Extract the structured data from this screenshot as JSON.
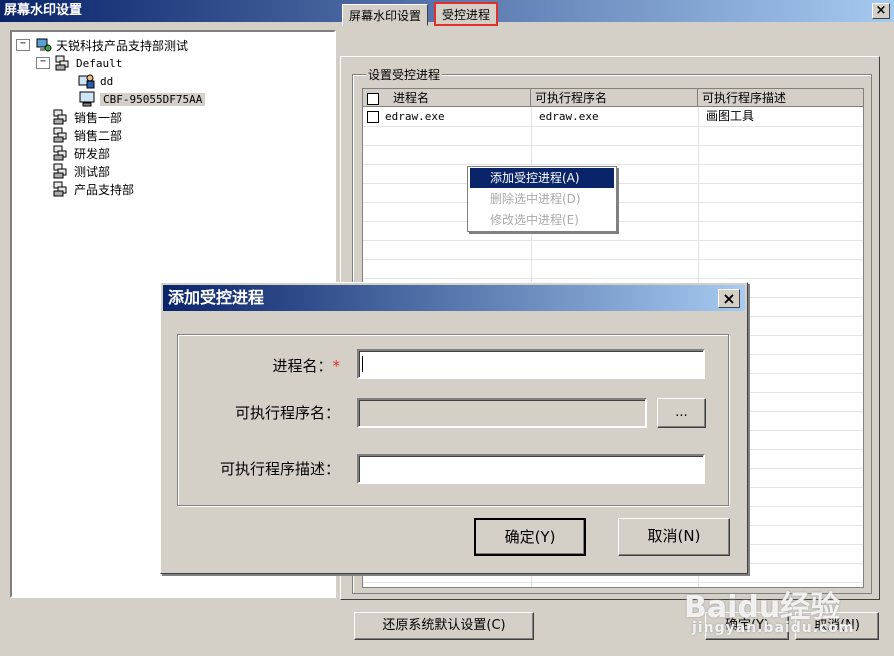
{
  "window": {
    "title": "屏幕水印设置",
    "close": "×"
  },
  "tree": {
    "root": "天锐科技产品支持部测试",
    "default_group": "Default",
    "users": [
      "dd",
      "CBF-95055DF75AA"
    ],
    "departments": [
      "销售一部",
      "销售二部",
      "研发部",
      "测试部",
      "产品支持部"
    ],
    "expander_minus": "−"
  },
  "tabs": [
    {
      "label": "屏幕水印设置"
    },
    {
      "label": "受控进程"
    }
  ],
  "group_label": "设置受控进程",
  "table": {
    "columns": [
      "进程名",
      "可执行程序名",
      "可执行程序描述"
    ],
    "rows": [
      {
        "process": "edraw.exe",
        "exe": "edraw.exe",
        "desc": "画图工具"
      }
    ]
  },
  "context_menu": {
    "items": [
      {
        "label": "添加受控进程(A)",
        "state": "selected"
      },
      {
        "label": "删除选中进程(D)",
        "state": "disabled"
      },
      {
        "label": "修改选中进程(E)",
        "state": "disabled"
      }
    ]
  },
  "dialog": {
    "title": "添加受控进程",
    "close": "×",
    "fields": {
      "process_label": "进程名：",
      "required_mark": "*",
      "exe_label": "可执行程序名：",
      "desc_label": "可执行程序描述：",
      "browse": "...",
      "process_value": "",
      "exe_value": "",
      "desc_value": ""
    },
    "ok": "确定(Y)",
    "cancel": "取消(N)"
  },
  "bottom": {
    "restore": "还原系统默认设置(C)",
    "ok": "确定(Y)",
    "cancel": "取消(N)"
  },
  "watermark": {
    "brand": "Baidu经验",
    "url": "jingyan.baidu.com"
  },
  "colors": {
    "title_bar": "#0a246a",
    "highlight": "#e0302a",
    "required": "#e0302a"
  },
  "icons": {
    "root": "network-computer-icon",
    "group": "group-icon",
    "user": "user-icon",
    "computer": "computer-icon"
  }
}
